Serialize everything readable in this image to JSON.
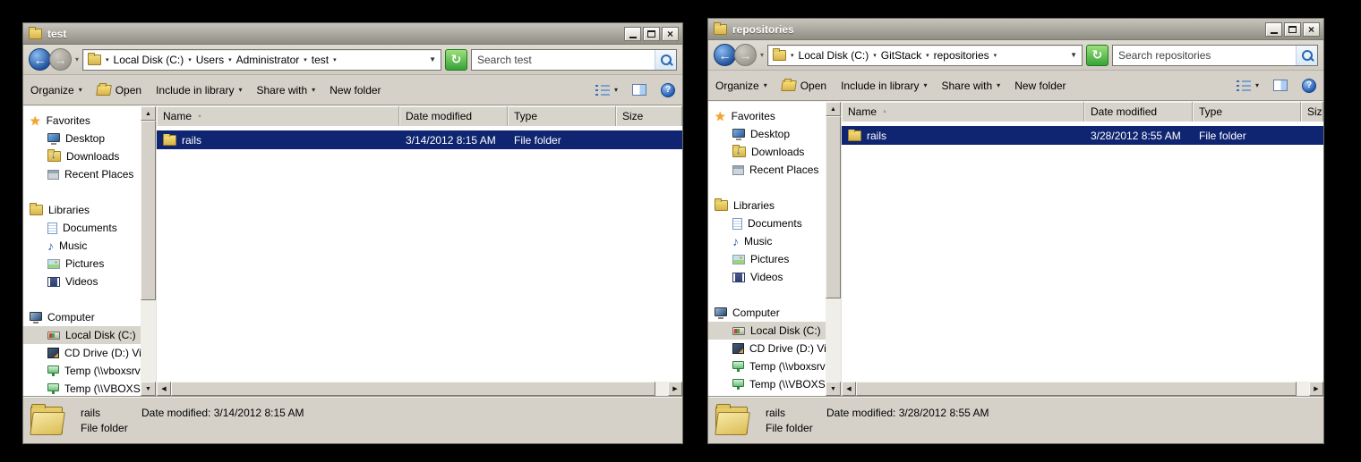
{
  "icons": {
    "close": "×",
    "back": "←",
    "forward": "→",
    "chevron": "▾",
    "crumb_sep": "▾",
    "overflow": "▼",
    "refresh": "↻",
    "scroll_up": "▲",
    "scroll_down": "▼",
    "scroll_left": "◀",
    "scroll_right": "▶",
    "sort_asc": "▲",
    "help": "?",
    "star": "★",
    "music_note": "♪",
    "downloads_arrow": "↓"
  },
  "colors": {
    "selection": "#0f2571",
    "chrome": "#d5d1c8",
    "refresh_green": "#37a336",
    "desktop_bg": "#000000"
  },
  "shared": {
    "toolbar": {
      "organize": "Organize",
      "open": "Open",
      "include": "Include in library",
      "share": "Share with",
      "new_folder": "New folder"
    },
    "columns": {
      "name": "Name",
      "date": "Date modified",
      "type": "Type",
      "size": "Size"
    },
    "sidebar": {
      "items": [
        {
          "label": "Favorites",
          "icon": "star"
        },
        {
          "label": "Desktop",
          "icon": "desktop"
        },
        {
          "label": "Downloads",
          "icon": "downloads"
        },
        {
          "label": "Recent Places",
          "icon": "recent-places"
        },
        {
          "label": "Libraries",
          "icon": "libraries"
        },
        {
          "label": "Documents",
          "icon": "documents"
        },
        {
          "label": "Music",
          "icon": "music"
        },
        {
          "label": "Pictures",
          "icon": "pictures"
        },
        {
          "label": "Videos",
          "icon": "videos"
        },
        {
          "label": "Computer",
          "icon": "computer"
        },
        {
          "label": "Local Disk (C:)",
          "icon": "local-disk",
          "selected": true
        },
        {
          "label": "CD Drive (D:) Virtua",
          "icon": "cd-drive"
        },
        {
          "label": "Temp (\\\\vboxsrv) (",
          "icon": "network-drive"
        },
        {
          "label": "Temp (\\\\VBOXSVR)",
          "icon": "network-drive"
        }
      ]
    }
  },
  "windows": {
    "left": {
      "title": "test",
      "breadcrumb": [
        "Local Disk (C:)",
        "Users",
        "Administrator",
        "test"
      ],
      "search_placeholder": "Search test",
      "row": {
        "name": "rails",
        "date": "3/14/2012 8:15 AM",
        "type": "File folder",
        "size": ""
      },
      "details": {
        "name": "rails",
        "modified_label": "Date modified:",
        "modified": "3/14/2012 8:15 AM",
        "type": "File folder"
      }
    },
    "right": {
      "title": "repositories",
      "breadcrumb": [
        "Local Disk (C:)",
        "GitStack",
        "repositories"
      ],
      "search_placeholder": "Search repositories",
      "row": {
        "name": "rails",
        "date": "3/28/2012 8:55 AM",
        "type": "File folder",
        "size": ""
      },
      "details": {
        "name": "rails",
        "modified_label": "Date modified:",
        "modified": "3/28/2012 8:55 AM",
        "type": "File folder"
      }
    }
  }
}
